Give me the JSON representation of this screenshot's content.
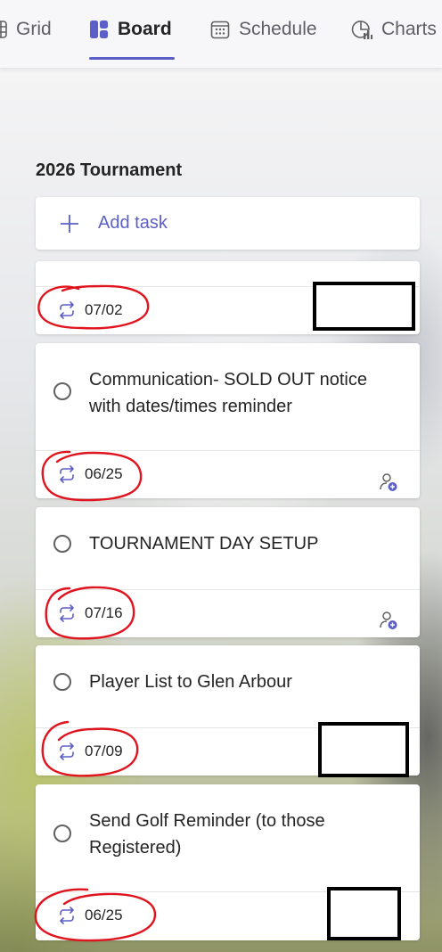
{
  "tabs": [
    {
      "label": "Grid",
      "icon": "grid-icon",
      "active": false
    },
    {
      "label": "Board",
      "icon": "board-icon",
      "active": true
    },
    {
      "label": "Schedule",
      "icon": "calendar-icon",
      "active": false
    },
    {
      "label": "Charts",
      "icon": "chart-icon",
      "active": false
    }
  ],
  "bucket": {
    "title": "2026 Tournament",
    "add_task_label": "Add task"
  },
  "tasks": [
    {
      "title": "",
      "due": "07/02",
      "recurring": true,
      "assignee": "redacted"
    },
    {
      "title": "Communication- SOLD OUT notice with dates/times reminder",
      "due": "06/25",
      "recurring": true,
      "assignee": "assign-icon"
    },
    {
      "title": "TOURNAMENT DAY SETUP",
      "due": "07/16",
      "recurring": true,
      "assignee": "assign-icon"
    },
    {
      "title": "Player List to Glen Arbour",
      "due": "07/09",
      "recurring": true,
      "assignee": "redacted"
    },
    {
      "title": "Send Golf Reminder (to those Registered)",
      "due": "06/25",
      "recurring": true,
      "assignee": "redacted"
    }
  ],
  "colors": {
    "accent": "#5b5fc7",
    "annotation": "#e0141e",
    "redaction": "#000000"
  }
}
